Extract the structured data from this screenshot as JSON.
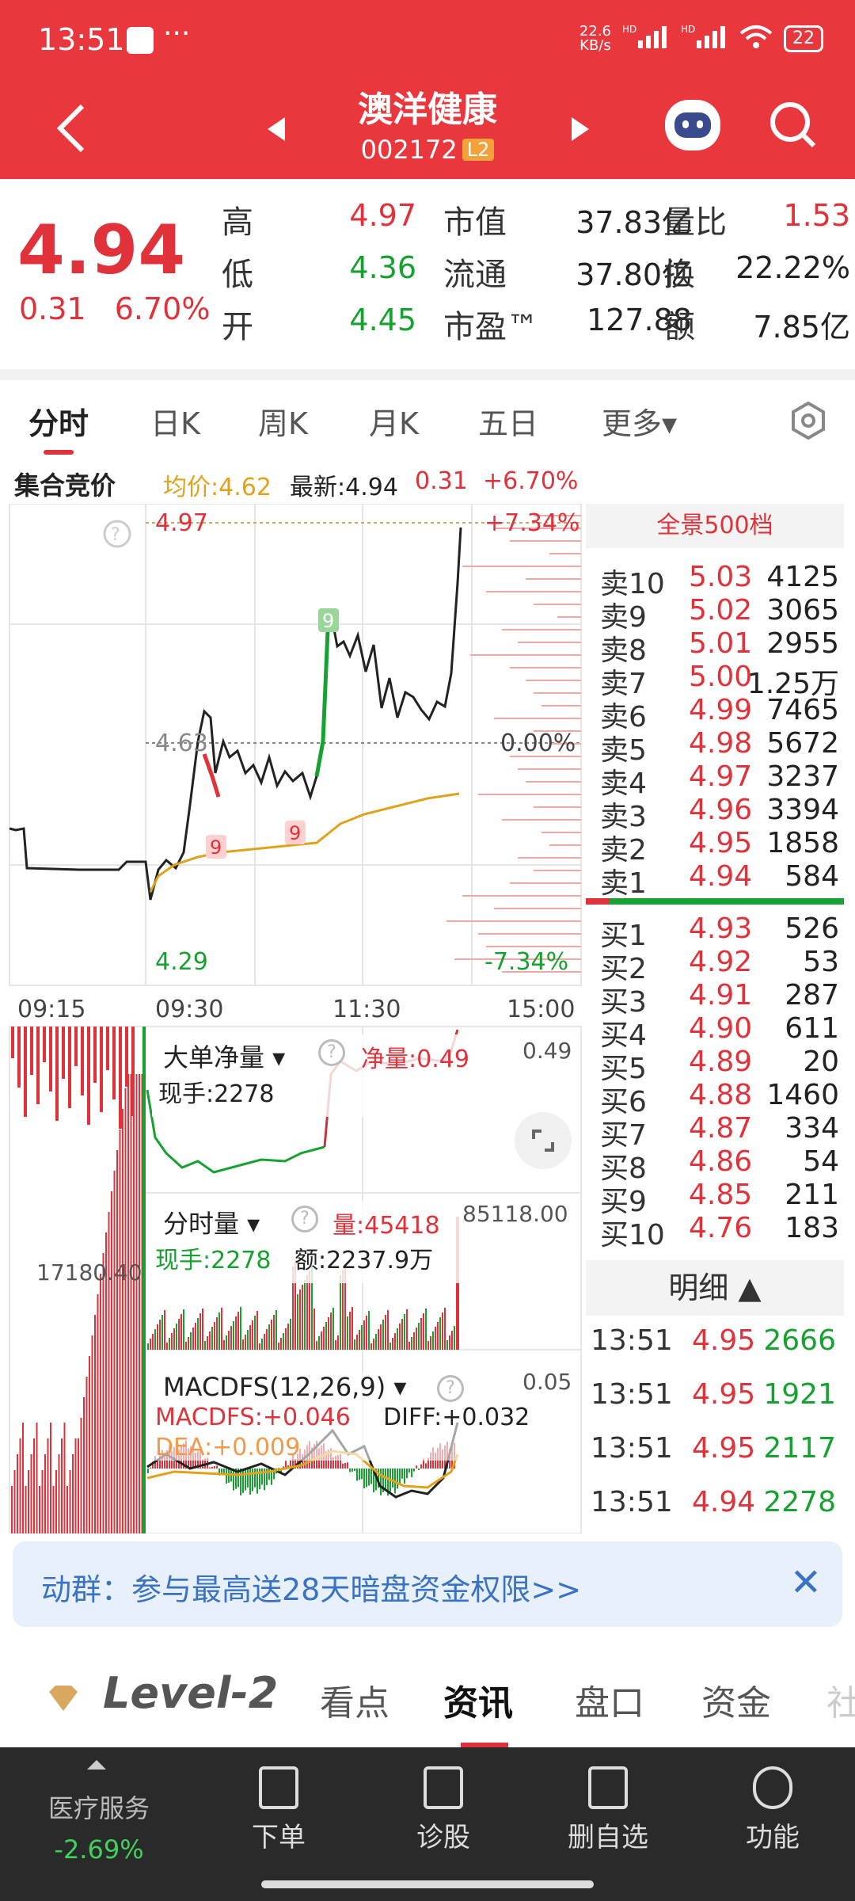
{
  "status": {
    "time": "13:51",
    "dots": "···",
    "speed": "22.6\nKB/s",
    "net1": "HD",
    "net2": "HD",
    "battery": "22"
  },
  "header": {
    "name": "澳洋健康",
    "code": "002172",
    "level_tag": "L2"
  },
  "quote": {
    "price": "4.94",
    "change": "0.31",
    "change_pct": "6.70%",
    "rows": [
      [
        {
          "l": "高",
          "v": "4.97",
          "c": "red"
        },
        {
          "l": "市值",
          "v": "37.83亿",
          "c": "dark"
        },
        {
          "l": "量比",
          "v": "1.53",
          "c": "red"
        }
      ],
      [
        {
          "l": "低",
          "v": "4.36",
          "c": "green"
        },
        {
          "l": "流通",
          "v": "37.80亿",
          "c": "dark"
        },
        {
          "l": "换",
          "v": "22.22%",
          "c": "dark"
        }
      ],
      [
        {
          "l": "开",
          "v": "4.45",
          "c": "green"
        },
        {
          "l": "市盈™",
          "v": "127.88",
          "c": "dark"
        },
        {
          "l": "额",
          "v": "7.85亿",
          "c": "dark"
        }
      ]
    ]
  },
  "tabs": [
    "分时",
    "日K",
    "周K",
    "月K",
    "五日",
    "更多▾"
  ],
  "inforow": {
    "label": "集合竞价",
    "avg": "均价:4.62",
    "latest": "最新:4.94",
    "chg": "0.31",
    "pct": "+6.70%"
  },
  "chart": {
    "high_price": "4.97",
    "high_pct": "+7.34%",
    "mid_price": "4.63",
    "mid_pct": "0.00%",
    "low_price": "4.29",
    "low_pct": "-7.34%",
    "times": [
      "09:15",
      "09:30",
      "11:30",
      "15:00"
    ],
    "nine": "9",
    "flow": {
      "title": "大单净量 ▾",
      "hand": "现手:2278",
      "net": "净量:0.49",
      "val": "0.49"
    },
    "vol": {
      "title": "分时量 ▾",
      "qty": "量:45418",
      "max": "85118.00",
      "hand": "现手:2278",
      "amt": "额:2237.9万",
      "left": "17180.40"
    },
    "macd": {
      "title": "MACDFS(12,26,9) ▾",
      "macdfs": "MACDFS:+0.046",
      "diff": "DIFF:+0.032",
      "dea": "DEA:+0.009",
      "val": "0.05"
    }
  },
  "book": {
    "title": "全景500档",
    "sells": [
      {
        "l": "卖10",
        "p": "5.03",
        "v": "4125",
        "pc": "red"
      },
      {
        "l": "卖9",
        "p": "5.02",
        "v": "3065",
        "pc": "red"
      },
      {
        "l": "卖8",
        "p": "5.01",
        "v": "2955",
        "pc": "red"
      },
      {
        "l": "卖7",
        "p": "5.00",
        "v": "1.25万",
        "pc": "red"
      },
      {
        "l": "卖6",
        "p": "4.99",
        "v": "7465",
        "pc": "red"
      },
      {
        "l": "卖5",
        "p": "4.98",
        "v": "5672",
        "pc": "red"
      },
      {
        "l": "卖4",
        "p": "4.97",
        "v": "3237",
        "pc": "red"
      },
      {
        "l": "卖3",
        "p": "4.96",
        "v": "3394",
        "pc": "red"
      },
      {
        "l": "卖2",
        "p": "4.95",
        "v": "1858",
        "pc": "red"
      },
      {
        "l": "卖1",
        "p": "4.94",
        "v": "584",
        "pc": "red"
      }
    ],
    "buys": [
      {
        "l": "买1",
        "p": "4.93",
        "v": "526",
        "pc": "red"
      },
      {
        "l": "买2",
        "p": "4.92",
        "v": "53",
        "pc": "red"
      },
      {
        "l": "买3",
        "p": "4.91",
        "v": "287",
        "pc": "red"
      },
      {
        "l": "买4",
        "p": "4.90",
        "v": "611",
        "pc": "red"
      },
      {
        "l": "买5",
        "p": "4.89",
        "v": "20",
        "pc": "red"
      },
      {
        "l": "买6",
        "p": "4.88",
        "v": "1460",
        "pc": "red"
      },
      {
        "l": "买7",
        "p": "4.87",
        "v": "334",
        "pc": "red"
      },
      {
        "l": "买8",
        "p": "4.86",
        "v": "54",
        "pc": "red"
      },
      {
        "l": "买9",
        "p": "4.85",
        "v": "211",
        "pc": "red"
      },
      {
        "l": "买10",
        "p": "4.76",
        "v": "183",
        "pc": "red"
      }
    ],
    "detail_title": "明细 ▲",
    "details": [
      {
        "t": "13:51",
        "p": "4.95",
        "v": "2666"
      },
      {
        "t": "13:51",
        "p": "4.95",
        "v": "1921"
      },
      {
        "t": "13:51",
        "p": "4.95",
        "v": "2117"
      },
      {
        "t": "13:51",
        "p": "4.94",
        "v": "2278"
      }
    ]
  },
  "banner": {
    "text": "动群：参与最高送28天暗盘资金权限>>",
    "close": "✕"
  },
  "bottom_tabs": {
    "level2": "Level-2",
    "items": [
      "看点",
      "资讯",
      "盘口",
      "资金",
      "社"
    ]
  },
  "footer": {
    "sector": "医疗服务",
    "sector_pct": "-2.69%",
    "items": [
      "下单",
      "诊股",
      "删自选",
      "功能"
    ]
  }
}
